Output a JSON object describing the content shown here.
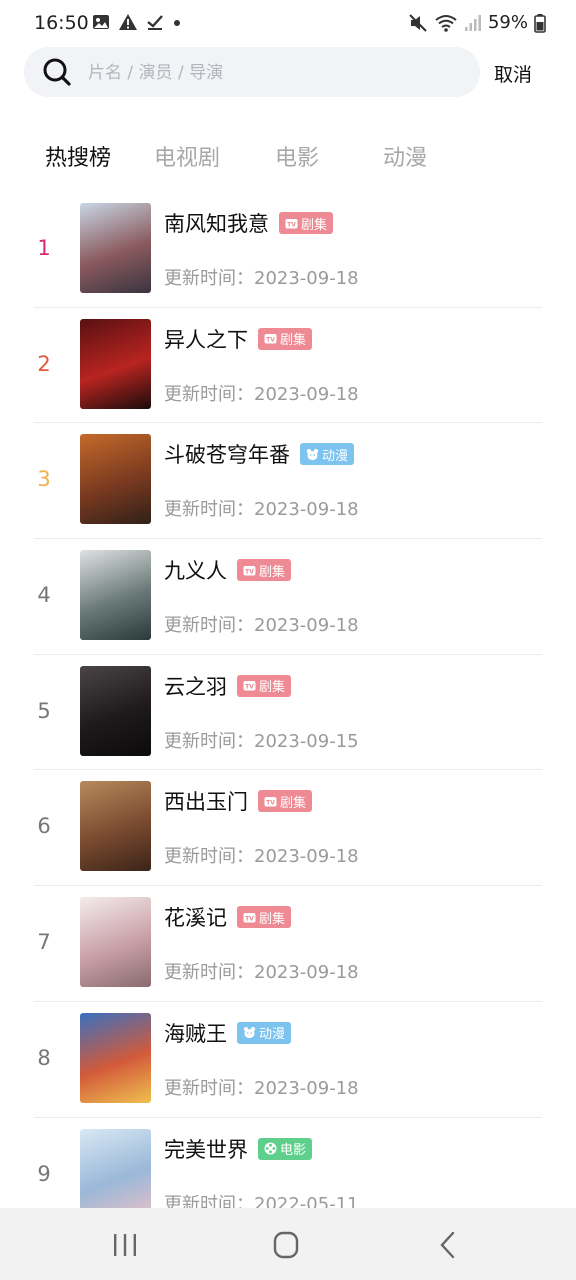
{
  "status_bar": {
    "time": "16:50",
    "battery": "59%",
    "left_icons": [
      "image-icon",
      "warning-icon",
      "check-icon",
      "dot-icon"
    ],
    "right_icons": [
      "mute-icon",
      "wifi-icon",
      "signal-icon",
      "battery-icon"
    ]
  },
  "search": {
    "placeholder": "片名 / 演员 / 导演",
    "value": "",
    "cancel_label": "取消"
  },
  "tabs": [
    {
      "label": "热搜榜",
      "active": true
    },
    {
      "label": "电视剧",
      "active": false
    },
    {
      "label": "电影",
      "active": false
    },
    {
      "label": "动漫",
      "active": false
    }
  ],
  "badge_types": {
    "drama": {
      "label": "剧集",
      "icon": "tv-icon",
      "color": "#ee8a93"
    },
    "anime": {
      "label": "动漫",
      "icon": "bear-icon",
      "color": "#7cc3ef"
    },
    "movie": {
      "label": "电影",
      "icon": "film-reel-icon",
      "color": "#5fd08c"
    }
  },
  "rank_colors": {
    "1": "#d62878",
    "2": "#e05a3a",
    "3": "#f0b04a",
    "default": "#777777"
  },
  "update_prefix": "更新时间：",
  "items": [
    {
      "rank": "1",
      "title": "南风知我意",
      "badge": "剧集",
      "badge_type": "drama",
      "updated": "2023-09-18",
      "poster_colors": [
        "#c8d6e4",
        "#8a5a5e",
        "#3a3440"
      ]
    },
    {
      "rank": "2",
      "title": "异人之下",
      "badge": "剧集",
      "badge_type": "drama",
      "updated": "2023-09-18",
      "poster_colors": [
        "#5a1012",
        "#b82420",
        "#1a0c0c"
      ]
    },
    {
      "rank": "3",
      "title": "斗破苍穹年番",
      "badge": "动漫",
      "badge_type": "anime",
      "updated": "2023-09-18",
      "poster_colors": [
        "#c46a2a",
        "#7a3a20",
        "#302018"
      ]
    },
    {
      "rank": "4",
      "title": "九义人",
      "badge": "剧集",
      "badge_type": "drama",
      "updated": "2023-09-18",
      "poster_colors": [
        "#dfe2e2",
        "#6a7a78",
        "#2a3a38"
      ]
    },
    {
      "rank": "5",
      "title": "云之羽",
      "badge": "剧集",
      "badge_type": "drama",
      "updated": "2023-09-15",
      "poster_colors": [
        "#4a4446",
        "#1e1a1c",
        "#0c0a0a"
      ]
    },
    {
      "rank": "6",
      "title": "西出玉门",
      "badge": "剧集",
      "badge_type": "drama",
      "updated": "2023-09-18",
      "poster_colors": [
        "#b88a5c",
        "#7a4a30",
        "#3a2418"
      ]
    },
    {
      "rank": "7",
      "title": "花溪记",
      "badge": "剧集",
      "badge_type": "drama",
      "updated": "2023-09-18",
      "poster_colors": [
        "#f4ecec",
        "#c9a0a8",
        "#8a6a70"
      ]
    },
    {
      "rank": "8",
      "title": "海贼王",
      "badge": "动漫",
      "badge_type": "anime",
      "updated": "2023-09-18",
      "poster_colors": [
        "#3a70c0",
        "#d25a3a",
        "#f0c050"
      ]
    },
    {
      "rank": "9",
      "title": "完美世界",
      "badge": "电影",
      "badge_type": "movie",
      "updated": "2022-05-11",
      "poster_colors": [
        "#d8e8f4",
        "#9ab8d8",
        "#e8c0c8"
      ]
    }
  ],
  "nav": [
    {
      "name": "recent-apps-icon"
    },
    {
      "name": "home-icon"
    },
    {
      "name": "back-icon"
    }
  ]
}
